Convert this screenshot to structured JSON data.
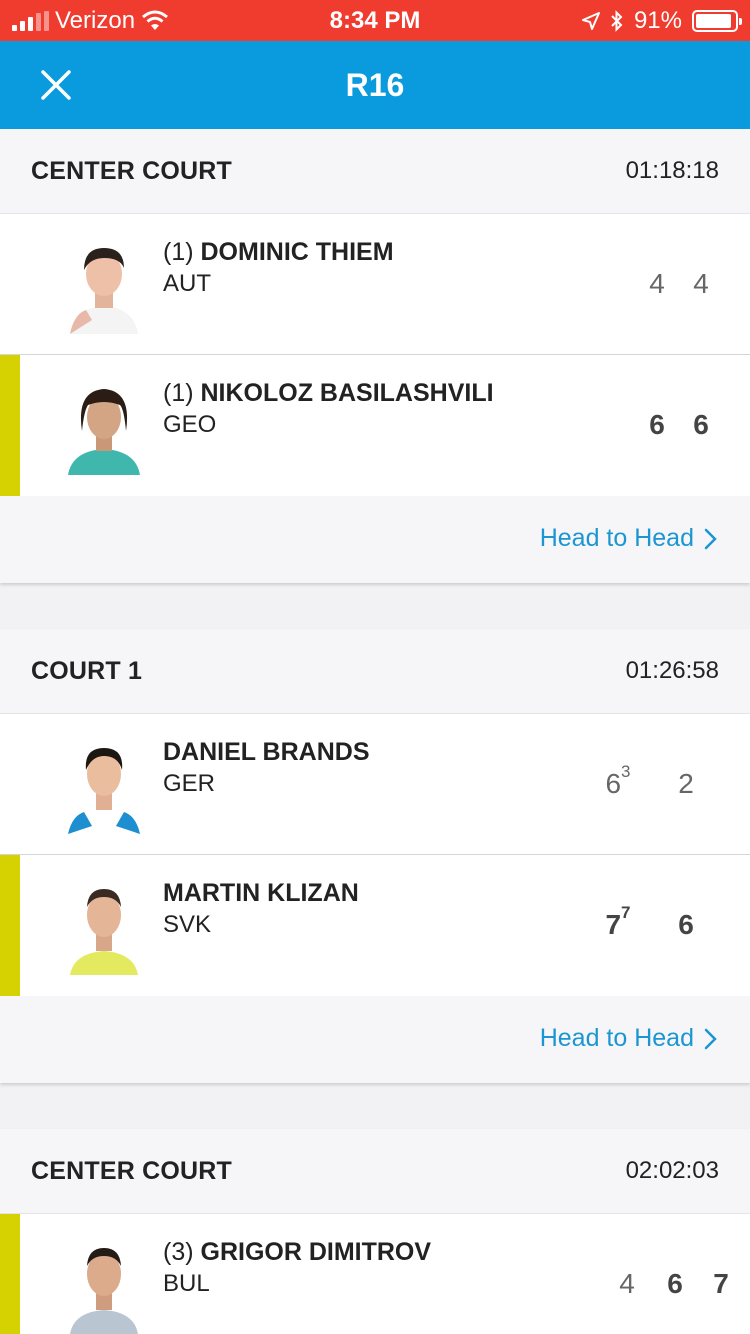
{
  "status_bar": {
    "carrier": "Verizon",
    "time": "8:34 PM",
    "battery": "91%",
    "battery_level": 0.91
  },
  "nav": {
    "title": "R16",
    "close_icon": "close-icon"
  },
  "matches": [
    {
      "court": "CENTER COURT",
      "duration": "01:18:18",
      "players": [
        {
          "seed": "(1) ",
          "name": "DOMINIC THIEM",
          "country": "AUT",
          "winner": false,
          "sets": [
            {
              "games": "4",
              "tb": ""
            },
            {
              "games": "4",
              "tb": ""
            }
          ]
        },
        {
          "seed": "(1) ",
          "name": "NIKOLOZ BASILASHVILI",
          "country": "GEO",
          "winner": true,
          "sets": [
            {
              "games": "6",
              "tb": ""
            },
            {
              "games": "6",
              "tb": ""
            }
          ]
        }
      ],
      "h2h_label": "Head to Head"
    },
    {
      "court": "COURT 1",
      "duration": "01:26:58",
      "players": [
        {
          "seed": "",
          "name": "DANIEL BRANDS",
          "country": "GER",
          "winner": false,
          "sets": [
            {
              "games": "6",
              "tb": "3"
            },
            {
              "games": "2",
              "tb": ""
            }
          ]
        },
        {
          "seed": "",
          "name": "MARTIN KLIZAN",
          "country": "SVK",
          "winner": true,
          "sets": [
            {
              "games": "7",
              "tb": "7"
            },
            {
              "games": "6",
              "tb": ""
            }
          ]
        }
      ],
      "h2h_label": "Head to Head"
    },
    {
      "court": "CENTER COURT",
      "duration": "02:02:03",
      "players": [
        {
          "seed": "(3) ",
          "name": "GRIGOR DIMITROV",
          "country": "BUL",
          "winner": true,
          "sets": [
            {
              "games": "4",
              "tb": ""
            },
            {
              "games": "6",
              "tb": ""
            },
            {
              "games": "7",
              "tb": ""
            }
          ]
        }
      ]
    }
  ],
  "colors": {
    "status_bar": "#f03b2f",
    "nav_bar": "#0a9bde",
    "winner_marker": "#d6d100",
    "link": "#1b96d2"
  }
}
